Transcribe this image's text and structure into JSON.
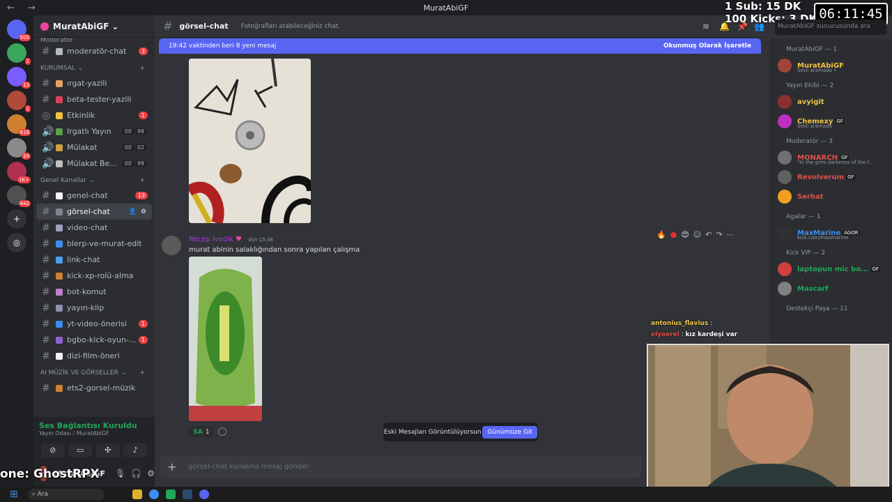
{
  "window": {
    "title": "MuratAbiGF",
    "back": "←",
    "forward": "→"
  },
  "stream_overlay": {
    "sub_goal": "1 Sub: 15 DK",
    "kicks_goal": "100 Kicks: 3 DK",
    "timer": "06:11:45",
    "donor_line": "one: GhostRPX"
  },
  "servers": {
    "items": [
      {
        "name": "discord-home-icon",
        "badge": "505",
        "color": "#5865f2"
      },
      {
        "name": "server-1",
        "badge": "1",
        "color": "#3ba55c"
      },
      {
        "name": "server-2",
        "badge": "13",
        "color": "#7a5cff"
      },
      {
        "name": "server-3",
        "badge": "1",
        "color": "#b04a3a"
      },
      {
        "name": "server-4",
        "badge": "618",
        "color": "#d08030"
      },
      {
        "name": "server-5",
        "badge": "24",
        "color": "#8a8a8a"
      },
      {
        "name": "server-6",
        "badge": "1K+",
        "color": "#b03050"
      },
      {
        "name": "server-7",
        "badge": "642",
        "color": "#505050"
      }
    ]
  },
  "sidebar": {
    "server_name": "MuratAbiGF",
    "top_category": "Moderatör",
    "top_channels": [
      {
        "label": "moderatör-chat",
        "badge": "3",
        "emoji_color": "#b5bac1"
      }
    ],
    "categories": [
      {
        "label": "KURUMSAL",
        "channels": [
          {
            "label": "ırgat-yazili",
            "badge": "",
            "emoji_color": "#e8a060",
            "type": "text"
          },
          {
            "label": "beta-tester-yazili",
            "badge": "",
            "emoji_color": "#e0405a",
            "type": "text"
          },
          {
            "label": "Etkinlik",
            "badge": "1",
            "emoji_color": "#f0c040",
            "type": "stage"
          },
          {
            "label": "Irgatlı Yayın",
            "badge": "",
            "count_a": "00",
            "count_b": "99",
            "emoji_color": "#60a050",
            "type": "voice"
          },
          {
            "label": "Mülakat",
            "badge": "",
            "count_a": "00",
            "count_b": "02",
            "emoji_color": "#d0a040",
            "type": "voice"
          },
          {
            "label": "Mülakat Be...",
            "badge": "",
            "count_a": "00",
            "count_b": "99",
            "emoji_color": "#c0c0c0",
            "type": "voice"
          }
        ]
      },
      {
        "label": "Genel Kanallar",
        "channels": [
          {
            "label": "genel-chat",
            "badge": "13",
            "emoji_color": "#f2f3f5",
            "type": "text"
          },
          {
            "label": "görsel-chat",
            "badge": "",
            "emoji_color": "#80848e",
            "type": "text",
            "active": true
          },
          {
            "label": "video-chat",
            "badge": "",
            "emoji_color": "#a0a0c0",
            "type": "text"
          },
          {
            "label": "blerp-ve-murat-edit",
            "badge": "",
            "emoji_color": "#3b8ef0",
            "type": "text"
          },
          {
            "label": "link-chat",
            "badge": "",
            "emoji_color": "#4aa0f0",
            "type": "text"
          },
          {
            "label": "kick-xp-rolü-alma",
            "badge": "",
            "emoji_color": "#d08030",
            "type": "text"
          },
          {
            "label": "bot-komut",
            "badge": "",
            "emoji_color": "#c080d0",
            "type": "text"
          },
          {
            "label": "yayın-klip",
            "badge": "",
            "emoji_color": "#9090b0",
            "type": "text"
          },
          {
            "label": "yt-video-önerisi",
            "badge": "1",
            "emoji_color": "#3b8ef0",
            "type": "text"
          },
          {
            "label": "bgbo-kick-oyun-...",
            "badge": "1",
            "emoji_color": "#9060d0",
            "type": "text"
          },
          {
            "label": "dizi-film-öneri",
            "badge": "",
            "emoji_color": "#f2f3f5",
            "type": "text"
          }
        ]
      },
      {
        "label": "AI MÜZİK VE GÖRSELLER",
        "channels": [
          {
            "label": "ets2-gorsel-müzik",
            "badge": "",
            "emoji_color": "#d08030",
            "type": "text"
          }
        ]
      }
    ],
    "voice_status": {
      "title": "Ses Bağlantısı Kuruldu",
      "subtitle": "Yayın Odası / MuratAbiGF"
    },
    "user": {
      "name": "MuratAbiGF"
    }
  },
  "channel_header": {
    "name": "görsel-chat",
    "topic": "Fotoğrafları atabileceğiniz chat."
  },
  "search": {
    "placeholder": "MuratAbiGF sunucusunda ara"
  },
  "new_messages_bar": {
    "text": "19:42 vaktinden beri 8 yeni mesaj",
    "action": "Okunmuş Olarak İşaretle"
  },
  "message": {
    "author": "Recep İvedik",
    "time": "dün 15:38",
    "text": "murat abinin salaklığından sonra yapılan çalışma",
    "reaction": {
      "emoji": "SA",
      "count": "1"
    }
  },
  "jump_bar": {
    "text": "Eski Mesajları Görüntülüyorsun",
    "button": "Günümüze Git"
  },
  "composer": {
    "placeholder": "görsel-chat kanalına mesaj gönder"
  },
  "members": {
    "groups": [
      {
        "label": "MuratAbiGF — 1",
        "members": [
          {
            "name": "MuratAbiGF",
            "color": "#f0c040",
            "status": "Sesli aramada •",
            "tag": "",
            "avatar": "#a0443a"
          }
        ]
      },
      {
        "label": "Yayın Ekibi — 2",
        "members": [
          {
            "name": "avyigit",
            "color": "#f0c040",
            "status": "",
            "tag": "",
            "avatar": "#8a3030"
          },
          {
            "name": "Chemexy",
            "color": "#f0c040",
            "status": "Sesli aramada",
            "tag": "GF",
            "avatar": "#c030c0"
          }
        ]
      },
      {
        "label": "Moderatör — 3",
        "members": [
          {
            "name": "MONARCH",
            "color": "#e0504a",
            "status": "\"In the grim darkness of the f...",
            "tag": "GF",
            "avatar": "#707070"
          },
          {
            "name": "Revolverum",
            "color": "#e0504a",
            "status": "",
            "tag": "GF",
            "avatar": "#606060"
          },
          {
            "name": "Serhat",
            "color": "#e0504a",
            "status": "",
            "tag": "",
            "avatar": "#f0a020"
          }
        ]
      },
      {
        "label": "Agalar — 1",
        "members": [
          {
            "name": "MaxMarine",
            "color": "#3b8ef0",
            "status": "kick.com/maxmarine",
            "tag": "AGOR",
            "avatar": "#303030"
          }
        ]
      },
      {
        "label": "Kick VIP — 2",
        "members": [
          {
            "name": "laptopun mic bo...",
            "color": "#23a55a",
            "status": "",
            "tag": "GF",
            "avatar": "#d04040"
          },
          {
            "name": "Mascarf",
            "color": "#23a55a",
            "status": "",
            "tag": "",
            "avatar": "#808080"
          }
        ]
      },
      {
        "label": "Destekçi Paşa — 11",
        "members": []
      }
    ]
  },
  "stream_chat": [
    {
      "user": "antonius_flavius",
      "text": ""
    },
    {
      "user": "elyaerel",
      "text": "kız kardeşi var"
    }
  ],
  "taskbar": {
    "search": "Ara"
  }
}
